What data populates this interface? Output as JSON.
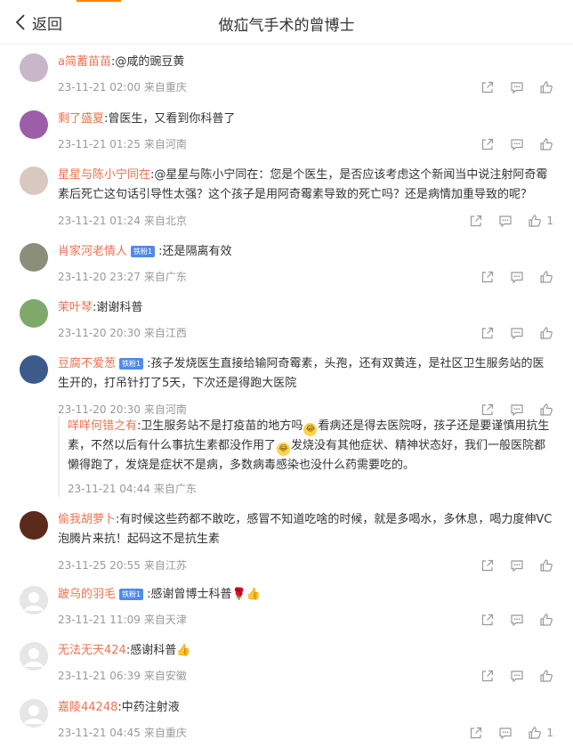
{
  "header": {
    "back_label": "返回",
    "title": "做疝气手术的曾博士"
  },
  "comments": [
    {
      "user": "a简蓄苗苗",
      "badge": "",
      "text": ":@咸的豌豆黄",
      "time": "23-11-21 02:00",
      "location": "来自重庆",
      "likes": "",
      "avatar_color": "#c7b7c9"
    },
    {
      "user": "剩了盛夏",
      "badge": "",
      "text": ":曾医生，又看到你科普了",
      "time": "23-11-21 01:25",
      "location": "来自河南",
      "likes": "",
      "avatar_color": "#9c5ea8"
    },
    {
      "user": "星星与陈小宁同在",
      "badge": "",
      "text": ":@星星与陈小宁同在：您是个医生，是否应该考虑这个新闻当中说注射阿奇霉素后死亡这句话引导性太强？这个孩子是用阿奇霉素导致的死亡吗？还是病情加重导致的呢？",
      "time": "23-11-21 01:24",
      "location": "来自北京",
      "likes": "1",
      "avatar_color": "#d9c8c0"
    },
    {
      "user": "肖家河老情人",
      "badge": "铁粉1",
      "text": ":还是隔离有效",
      "time": "23-11-20 23:27",
      "location": "来自广东",
      "likes": "",
      "avatar_color": "#8b8f79"
    },
    {
      "user": "茉叶琴",
      "badge": "",
      "text": ":谢谢科普",
      "time": "23-11-20 20:30",
      "location": "来自江西",
      "likes": "",
      "avatar_color": "#7fa96a"
    },
    {
      "user": "豆腐不爱葱",
      "badge": "铁粉1",
      "text": ":孩子发烧医生直接给输阿奇霉素，头孢，还有双黄连，是社区卫生服务站的医生开的，打吊针打了5天，下次还是得跑大医院",
      "time": "23-11-20 20:30",
      "location": "来自河南",
      "likes": "",
      "avatar_color": "#3c5a8a",
      "reply": {
        "user": "咩咩何错之有",
        "text_a": ":卫生服务站不是打疫苗的地方吗",
        "text_b": "看病还是得去医院呀，孩子还是要谨慎用抗生素，不然以后有什么事抗生素都没作用了",
        "text_c": "发烧没有其他症状、精神状态好，我们一般医院都懒得跑了，发烧是症状不是病，多数病毒感染也没什么药需要吃的。",
        "time": "23-11-21 04:44",
        "location": "来自广东"
      }
    },
    {
      "user": "偷我胡萝卜",
      "badge": "",
      "text": ":有时候这些药都不敢吃，感冒不知道吃啥的时候，就是多喝水，多休息，喝力度伸VC泡腾片来抗！起码这不是抗生素",
      "time": "23-11-25 20:55",
      "location": "来自江苏",
      "likes": "",
      "avatar_color": "#5a2a1a"
    },
    {
      "user": "跛乌的羽毛",
      "badge": "铁粉1",
      "text": ":感谢曾博士科普",
      "time": "23-11-21 11:09",
      "location": "来自天津",
      "likes": "",
      "avatar_color": "#dddddd",
      "emoji": [
        "rose",
        "thumb"
      ]
    },
    {
      "user": "无法无天424",
      "badge": "",
      "text": ":感谢科普",
      "time": "23-11-21 06:39",
      "location": "来自安徽",
      "likes": "",
      "avatar_color": "#dddddd",
      "emoji": [
        "thumb"
      ]
    },
    {
      "user": "嘉陵44248",
      "badge": "",
      "text": ":中药注射液",
      "time": "23-11-21 04:45",
      "location": "来自重庆",
      "likes": "1",
      "avatar_color": "#dddddd"
    }
  ]
}
